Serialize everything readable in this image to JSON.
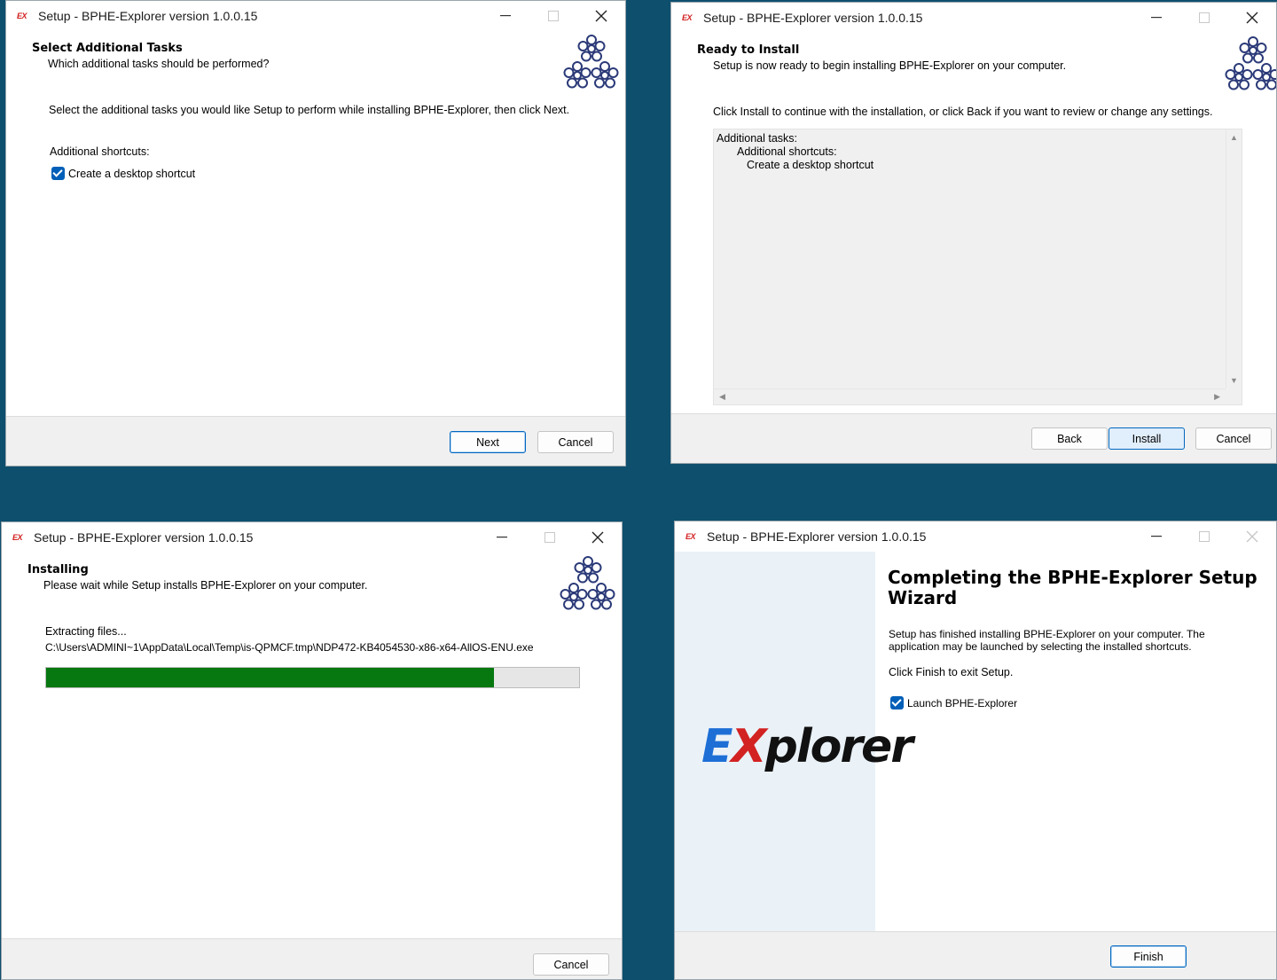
{
  "app_title": "Setup - BPHE-Explorer version 1.0.0.15",
  "icon_label": "EX",
  "colors": {
    "background": "#0e4f6e",
    "accent": "#005fb8",
    "progress": "#06780f",
    "logo_e": "#1d6fd6",
    "logo_x": "#d22222"
  },
  "w1": {
    "title": "Setup - BPHE-Explorer version 1.0.0.15",
    "heading": "Select Additional Tasks",
    "subheading": "Which additional tasks should be performed?",
    "instruction": "Select the additional tasks you would like Setup to perform while installing BPHE-Explorer, then click Next.",
    "group_label": "Additional shortcuts:",
    "checkbox_label": "Create a desktop shortcut",
    "checkbox_checked": true,
    "next_label": "Next",
    "cancel_label": "Cancel"
  },
  "w2": {
    "title": "Setup - BPHE-Explorer version 1.0.0.15",
    "heading": "Ready to Install",
    "subheading": "Setup is now ready to begin installing BPHE-Explorer on your computer.",
    "instruction": "Click Install to continue with the installation, or click Back if you want to review or change any settings.",
    "memo": [
      "Additional tasks:",
      "Additional shortcuts:",
      "Create a desktop shortcut"
    ],
    "back_label": "Back",
    "install_label": "Install",
    "cancel_label": "Cancel"
  },
  "w3": {
    "title": "Setup - BPHE-Explorer version 1.0.0.15",
    "heading": "Installing",
    "subheading": "Please wait while Setup installs BPHE-Explorer on your computer.",
    "status": "Extracting files...",
    "path": "C:\\Users\\ADMINI~1\\AppData\\Local\\Temp\\is-QPMCF.tmp\\NDP472-KB4054530-x86-x64-AllOS-ENU.exe",
    "progress": 0.84,
    "cancel_label": "Cancel"
  },
  "w4": {
    "title": "Setup - BPHE-Explorer version 1.0.0.15",
    "heading": "Completing the BPHE-Explorer Setup Wizard",
    "message": "Setup has finished installing BPHE-Explorer on your computer. The application may be launched by selecting the installed shortcuts.",
    "exit_text": "Click Finish to exit Setup.",
    "checkbox_label": "Launch BPHE-Explorer",
    "checkbox_checked": true,
    "logo": {
      "part1": "E",
      "part2": "X",
      "part3": "plorer"
    },
    "finish_label": "Finish"
  }
}
